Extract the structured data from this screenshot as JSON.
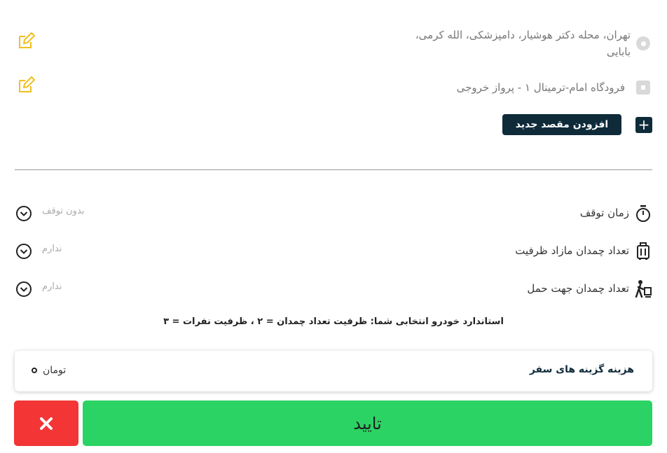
{
  "route": {
    "origin_line1": "تهران، محله دکتر هوشیار، دامپزشکی، الله کرمی،",
    "origin_line2": "بابایی",
    "destination": "فرودگاه امام-ترمینال ۱ - پرواز خروجی",
    "add_destination_label": "افزودن مقصد جدید",
    "plus_label": "+"
  },
  "options": {
    "stop_time": {
      "label": "زمان توقف",
      "value": "بدون توقف"
    },
    "extra_luggage": {
      "label": "تعداد چمدان مازاد ظرفیت",
      "value": "ندارم"
    },
    "carry_luggage": {
      "label": "تعداد چمدان جهت حمل",
      "value": "ندارم"
    }
  },
  "vehicle_info": "استاندارد خودرو انتخابی شما: ظرفیت تعداد چمدان = ۲ ، ظرفیت نفرات = ۳",
  "cost": {
    "title": "هزینه گزینه های سفر",
    "unit": "تومان"
  },
  "actions": {
    "confirm_label": "تایید",
    "cancel_symbol": "✕"
  },
  "colors": {
    "accent_dark": "#0f2b3a",
    "confirm": "#2bd364",
    "cancel": "#f33535",
    "edit_icon": "#f0c020"
  }
}
